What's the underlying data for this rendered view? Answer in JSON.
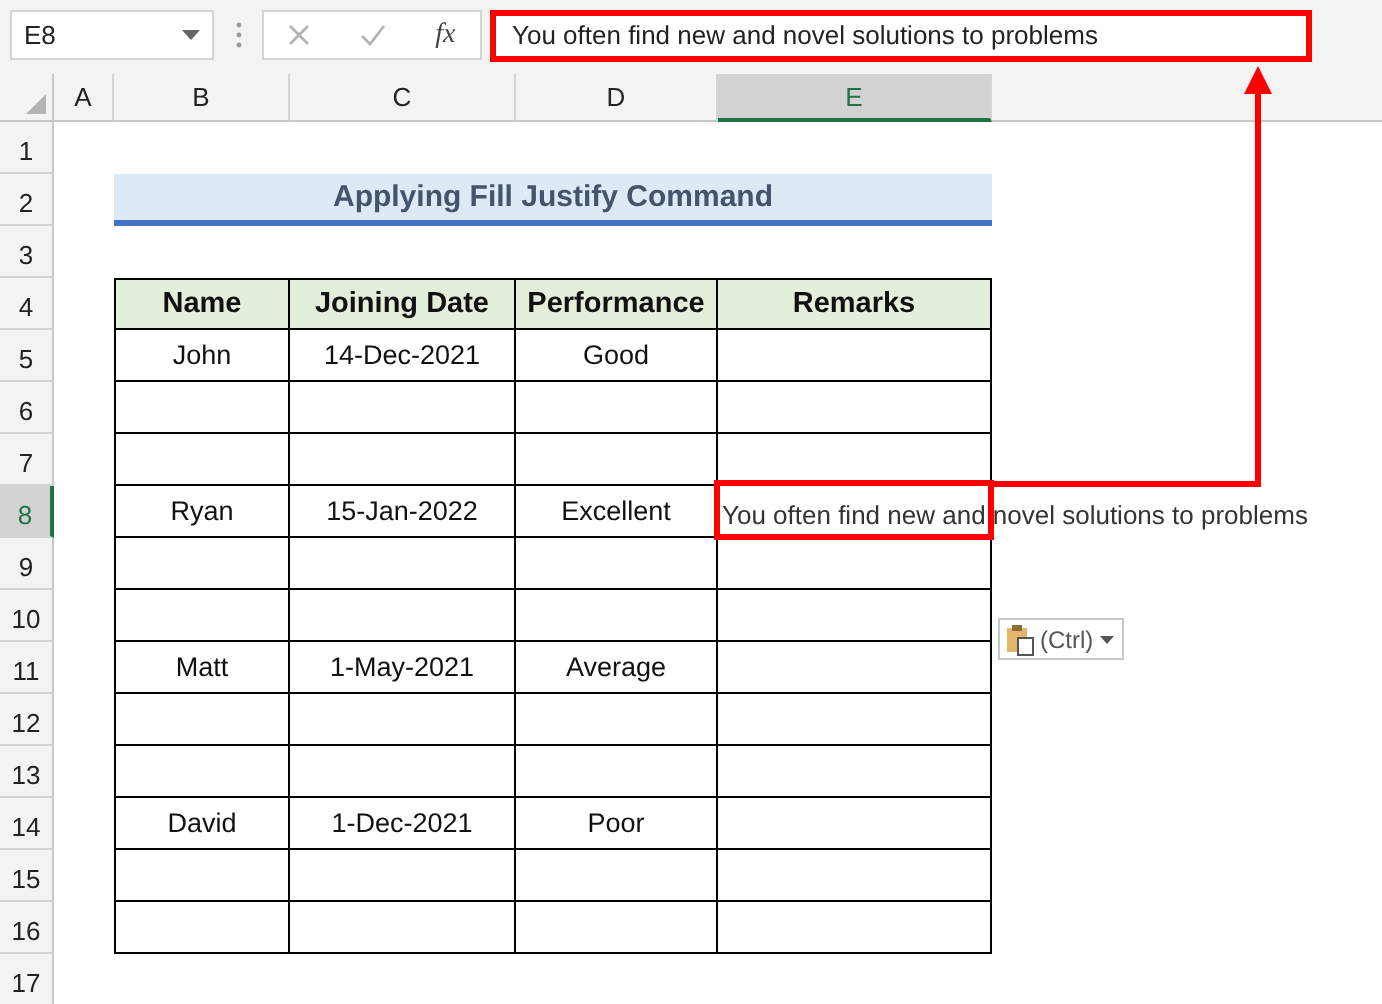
{
  "name_box": "E8",
  "function_label": "fx",
  "formula": "You often find new and novel solutions to problems",
  "columns": [
    {
      "label": "A",
      "selected": false
    },
    {
      "label": "B",
      "selected": false
    },
    {
      "label": "C",
      "selected": false
    },
    {
      "label": "D",
      "selected": false
    },
    {
      "label": "E",
      "selected": true
    }
  ],
  "rows": [
    {
      "label": "1",
      "selected": false
    },
    {
      "label": "2",
      "selected": false
    },
    {
      "label": "3",
      "selected": false
    },
    {
      "label": "4",
      "selected": false
    },
    {
      "label": "5",
      "selected": false
    },
    {
      "label": "6",
      "selected": false
    },
    {
      "label": "7",
      "selected": false
    },
    {
      "label": "8",
      "selected": true
    },
    {
      "label": "9",
      "selected": false
    },
    {
      "label": "10",
      "selected": false
    },
    {
      "label": "11",
      "selected": false
    },
    {
      "label": "12",
      "selected": false
    },
    {
      "label": "13",
      "selected": false
    },
    {
      "label": "14",
      "selected": false
    },
    {
      "label": "15",
      "selected": false
    },
    {
      "label": "16",
      "selected": false
    },
    {
      "label": "17",
      "selected": false
    }
  ],
  "title": "Applying Fill Justify Command",
  "table": {
    "headers": [
      "Name",
      "Joining Date",
      "Performance",
      "Remarks"
    ],
    "records": [
      {
        "name": "John",
        "joining_date": "14-Dec-2021",
        "performance": "Good"
      },
      {
        "name": "Ryan",
        "joining_date": "15-Jan-2022",
        "performance": "Excellent",
        "remarks": "You often find new and novel solutions to problems"
      },
      {
        "name": "Matt",
        "joining_date": "1-May-2021",
        "performance": "Average"
      },
      {
        "name": "David",
        "joining_date": "1-Dec-2021",
        "performance": "Poor"
      }
    ]
  },
  "paste_options": {
    "label": "(Ctrl)"
  }
}
